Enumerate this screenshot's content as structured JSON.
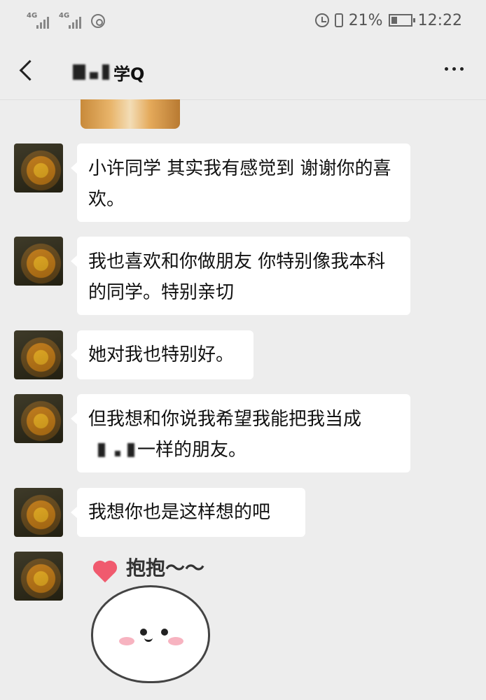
{
  "status_bar": {
    "signal1_label": "4G",
    "signal2_label": "4G",
    "battery_percent": "21%",
    "time": "12:22",
    "icons": [
      "signal-icon",
      "signal-icon",
      "nfc-icon",
      "alarm-icon",
      "vibrate-icon",
      "battery-charging-icon"
    ]
  },
  "nav": {
    "title_suffix": "学Q",
    "back_icon": "chevron-left-icon",
    "more_icon": "more-dots-icon"
  },
  "messages": [
    {
      "text": "小许同学 其实我有感觉到 谢谢你的喜欢。"
    },
    {
      "text": "我也喜欢和你做朋友 你特别像我本科的同学。特别亲切"
    },
    {
      "text": "她对我也特别好。"
    },
    {
      "text_line1": "但我想和你说我希望我能把我当成",
      "text_line2": "一样的朋友。"
    },
    {
      "text": "我想你也是这样想的吧"
    }
  ],
  "sticker": {
    "caption": "抱抱～～"
  },
  "colors": {
    "background": "#ededed",
    "bubble": "#ffffff",
    "heart": "#f05a6e"
  }
}
